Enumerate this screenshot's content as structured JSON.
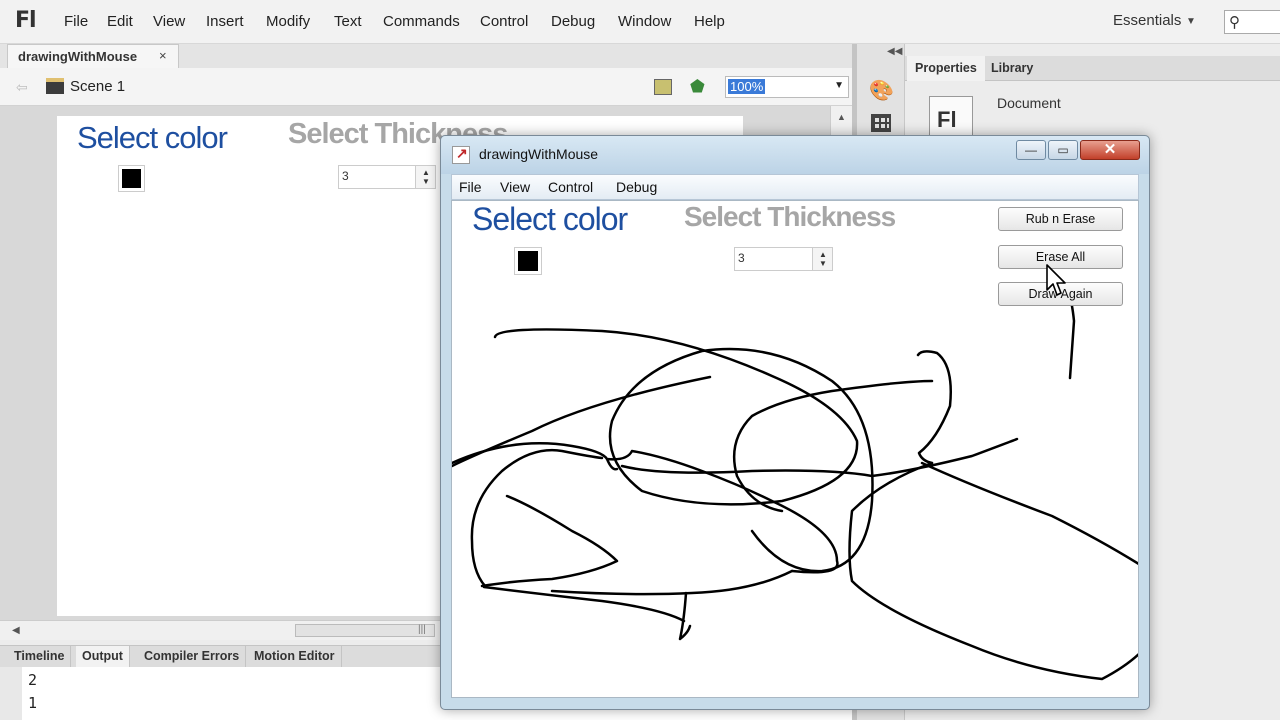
{
  "app": {
    "logo": "Fl",
    "menu": [
      "File",
      "Edit",
      "View",
      "Insert",
      "Modify",
      "Text",
      "Commands",
      "Control",
      "Debug",
      "Window",
      "Help"
    ],
    "workspace": "Essentials",
    "search_icon": "⚲"
  },
  "document": {
    "tab_label": "drawingWithMouse",
    "tab_close": "×",
    "scene_label": "Scene 1",
    "zoom": "100%"
  },
  "stage": {
    "color_heading": "Select color",
    "thickness_heading": "Select Thickness",
    "thickness_value": "3",
    "swatch_color": "#000000"
  },
  "bottom_panel": {
    "tabs": [
      "Timeline",
      "Output",
      "Compiler Errors",
      "Motion Editor"
    ],
    "active_tab": "Output",
    "output_lines": [
      "2",
      "1"
    ]
  },
  "right_panel": {
    "tabs": [
      "Properties",
      "Library"
    ],
    "active_tab": "Properties",
    "doc_icon": "Fl",
    "doc_label": "Document"
  },
  "player": {
    "title": "drawingWithMouse",
    "menu": [
      "File",
      "View",
      "Control",
      "Debug"
    ],
    "color_heading": "Select color",
    "thickness_heading": "Select Thickness",
    "thickness_value": "3",
    "swatch_color": "#000000",
    "buttons": [
      "Rub  n Erase",
      "Erase All",
      "Draw Again"
    ],
    "close_glyph": "✕",
    "min_glyph": "—",
    "max_glyph": "▭"
  },
  "colors": {
    "heading_blue": "#1e4fa0",
    "heading_gray": "#a6a6a6",
    "zoom_highlight": "#3a7ad8"
  }
}
